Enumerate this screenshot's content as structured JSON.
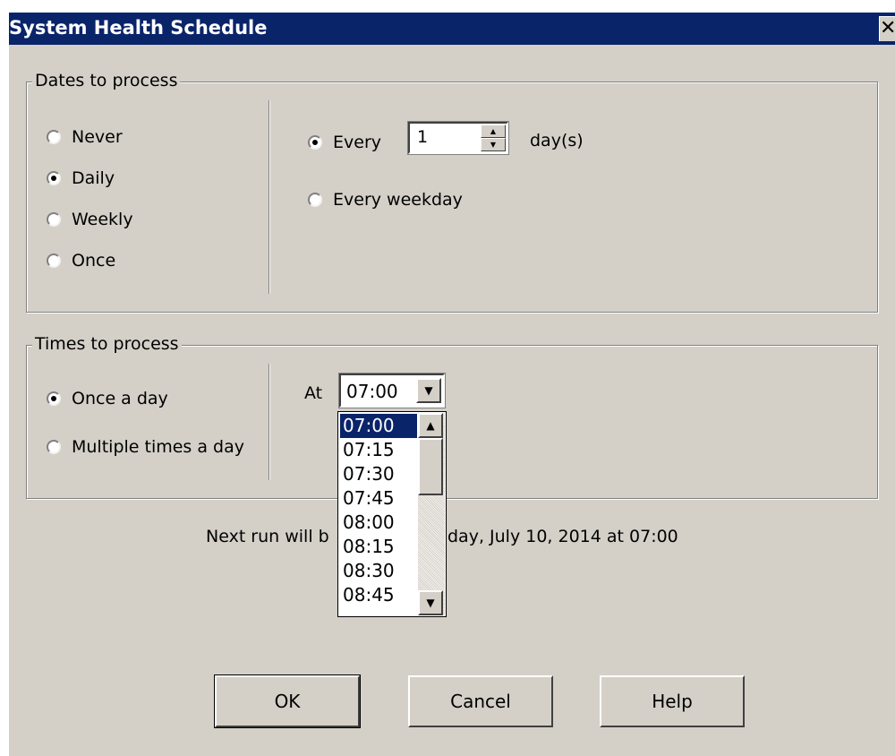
{
  "window": {
    "title": "System Health Schedule",
    "close_glyph": "✕"
  },
  "dates_group": {
    "label": "Dates to process",
    "options": [
      {
        "label": "Never",
        "checked": false
      },
      {
        "label": "Daily",
        "checked": true
      },
      {
        "label": "Weekly",
        "checked": false
      },
      {
        "label": "Once",
        "checked": false
      }
    ],
    "daily": {
      "every_label": "Every",
      "every_checked": true,
      "every_value": "1",
      "unit_label": "day(s)",
      "weekday_label": "Every weekday",
      "weekday_checked": false
    }
  },
  "times_group": {
    "label": "Times to process",
    "options": [
      {
        "label": "Once a day",
        "checked": true
      },
      {
        "label": "Multiple times a day",
        "checked": false
      }
    ],
    "at_label": "At",
    "time_value": "07:00",
    "time_options": [
      "07:00",
      "07:15",
      "07:30",
      "07:45",
      "08:00",
      "08:15",
      "08:30",
      "08:45"
    ],
    "selected_option": "07:00"
  },
  "next_run": {
    "text_left": "Next run will b",
    "text_right": "day, July 10, 2014 at 07:00"
  },
  "buttons": {
    "ok": "OK",
    "cancel": "Cancel",
    "help": "Help"
  },
  "icons": {
    "spin_up": "▲",
    "spin_down": "▼",
    "scroll_up": "▲",
    "scroll_down": "▼",
    "combo_arrow": "▼"
  },
  "colors": {
    "titlebar": "#0a246a",
    "dialog_face": "#d4d0c8",
    "selection": "#0a246a"
  }
}
